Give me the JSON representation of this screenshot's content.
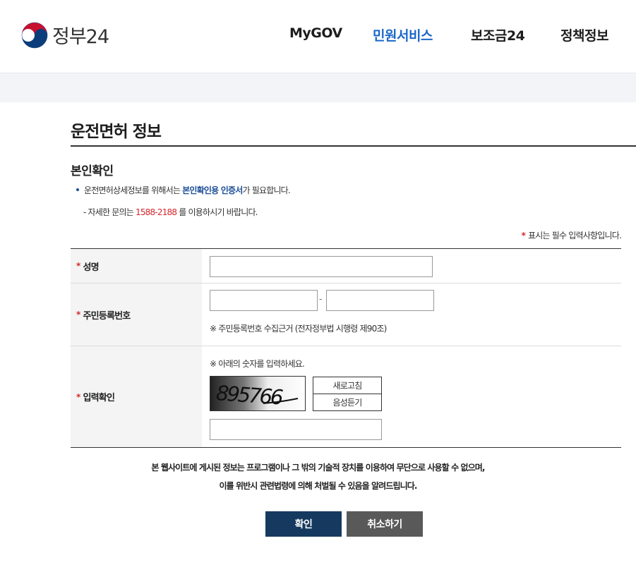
{
  "header": {
    "logo_text": "정부24",
    "nav": [
      {
        "label": "MyGOV"
      },
      {
        "label": "민원서비스"
      },
      {
        "label": "보조금24"
      },
      {
        "label": "정책정보"
      }
    ],
    "active_nav": "민원서비스"
  },
  "page": {
    "title": "운전면허 정보",
    "section_title": "본인확인",
    "bullet_pre": "운전면허상세정보를 위해서는 ",
    "bullet_strong": "본인확인용 인증서",
    "bullet_post": "가 필요합니다.",
    "contact_pre": "- 자세한 문의는 ",
    "contact_phone": "1588-2188",
    "contact_post": " 를 이용하시기 바랍니다.",
    "required_mark": "*",
    "required_note": "표시는 필수 입력사항입니다."
  },
  "form": {
    "name_label": "성명",
    "name_value": "",
    "rrn_label": "주민등록번호",
    "rrn_front_value": "",
    "rrn_back_value": "",
    "rrn_dash": "-",
    "rrn_note": "※ 주민등록번호 수집근거 (전자정부법 시행령 제90조)",
    "captcha_label": "입력확인",
    "captcha_note": "※ 아래의 숫자를 입력하세요.",
    "captcha_text": "895766",
    "captcha_refresh": "새로고침",
    "captcha_audio": "음성듣기",
    "captcha_value": ""
  },
  "notice": {
    "line1": "본 웹사이트에 게시된 정보는 프로그램이나 그 밖의 기술적 장치를 이용하여 무단으로 사용할 수 없으며,",
    "line2": "이를 위반시 관련법령에 의해 처벌될 수 있음을 알려드립니다."
  },
  "buttons": {
    "confirm": "확인",
    "cancel": "취소하기"
  },
  "colors": {
    "accent_blue": "#1a68c9",
    "confirm_bg": "#163a5f",
    "cancel_bg": "#595959",
    "required_red": "#d6262b"
  }
}
